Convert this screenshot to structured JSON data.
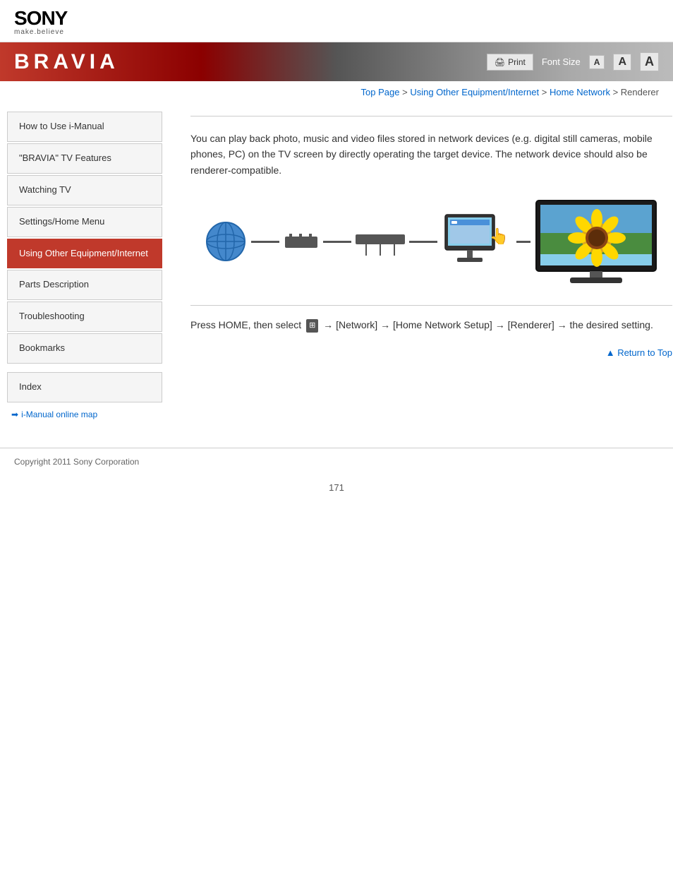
{
  "header": {
    "sony_logo": "SONY",
    "sony_tagline": "make.believe"
  },
  "banner": {
    "title": "BRAVIA",
    "print_label": "Print",
    "font_size_label": "Font Size",
    "font_small": "A",
    "font_medium": "A",
    "font_large": "A"
  },
  "breadcrumb": {
    "top_page": "Top Page",
    "sep1": " > ",
    "using_other": "Using Other Equipment/Internet",
    "sep2": " > ",
    "home_network": "Home Network",
    "sep3": " > ",
    "current": "Renderer"
  },
  "sidebar": {
    "items": [
      {
        "id": "how-to-use",
        "label": "How to Use i-Manual"
      },
      {
        "id": "bravia-features",
        "label": "\"BRAVIA\" TV Features"
      },
      {
        "id": "watching-tv",
        "label": "Watching TV"
      },
      {
        "id": "settings-home",
        "label": "Settings/Home Menu"
      },
      {
        "id": "using-other",
        "label": "Using Other Equipment/Internet",
        "active": true
      },
      {
        "id": "parts-description",
        "label": "Parts Description"
      },
      {
        "id": "troubleshooting",
        "label": "Troubleshooting"
      },
      {
        "id": "bookmarks",
        "label": "Bookmarks"
      }
    ],
    "index_label": "Index",
    "online_map_label": "i-Manual online map"
  },
  "content": {
    "description": "You can play back photo, music and video files stored in network devices (e.g. digital still cameras, mobile phones, PC) on the TV screen by directly operating the target device. The network device should also be renderer-compatible.",
    "steps": "Press HOME, then select",
    "steps_arrow1": "→",
    "steps_network": "[Network]",
    "steps_arrow2": "→",
    "steps_home_network_setup": "[Home Network Setup]",
    "steps_arrow3": "→",
    "steps_renderer": "[Renderer]",
    "steps_arrow4": "→",
    "steps_desired": "the desired setting.",
    "return_to_top": "Return to Top"
  },
  "footer": {
    "copyright": "Copyright 2011 Sony Corporation"
  },
  "page_number": "171"
}
